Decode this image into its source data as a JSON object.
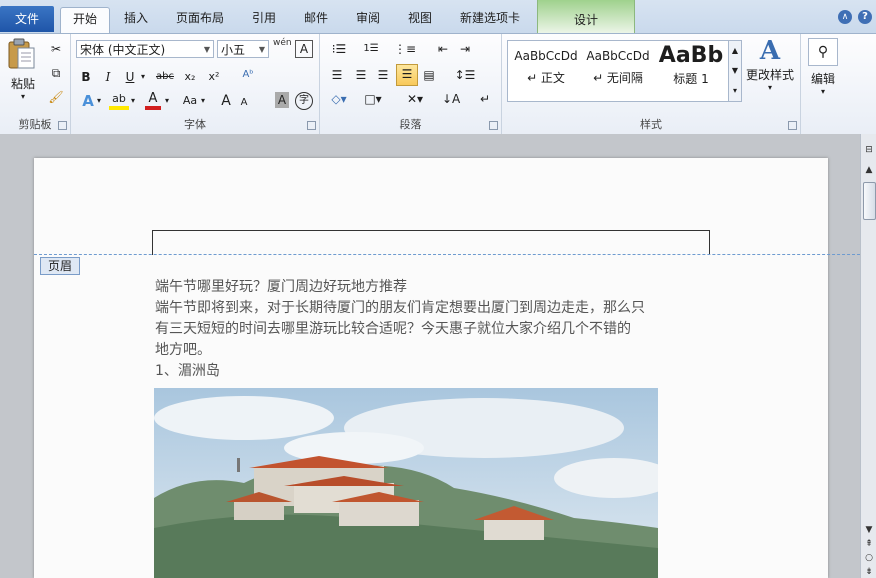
{
  "tabs": {
    "file": "文件",
    "home": "开始",
    "insert": "插入",
    "page_layout": "页面布局",
    "references": "引用",
    "mailings": "邮件",
    "review": "审阅",
    "view": "视图",
    "new_tab": "新建选项卡",
    "design": "设计"
  },
  "clipboard": {
    "paste_label": "粘贴",
    "group_label": "剪贴板"
  },
  "font": {
    "font_name": "宋体 (中文正文)",
    "font_size": "小五",
    "group_label": "字体",
    "bold": "B",
    "italic": "I",
    "underline": "U",
    "strike": "abc",
    "subscript": "x₂",
    "superscript": "x²",
    "grow": "A",
    "shrink": "A",
    "change_case": "Aa",
    "phonetic": "wén",
    "char_border": "A",
    "char_shading": "A",
    "enclose": "字"
  },
  "paragraph": {
    "group_label": "段落"
  },
  "styles": {
    "group_label": "样式",
    "items": [
      {
        "sample": "AaBbCcDd",
        "name": "↵ 正文"
      },
      {
        "sample": "AaBbCcDd",
        "name": "↵ 无间隔"
      },
      {
        "sample": "AaBb",
        "name": "标题 1"
      }
    ],
    "change_styles": "更改样式"
  },
  "editing": {
    "label": "编辑"
  },
  "document": {
    "header_tag": "页眉",
    "lines": [
      "端午节哪里好玩？厦门周边好玩地方推荐",
      "端午节即将到来，对于长期待厦门的朋友们肯定想要出厦门到周边走走，那么只",
      "有三天短短的时间去哪里游玩比较合适呢？今天惠子就位大家介绍几个不错的",
      "地方吧。",
      "1、湄洲岛"
    ]
  }
}
